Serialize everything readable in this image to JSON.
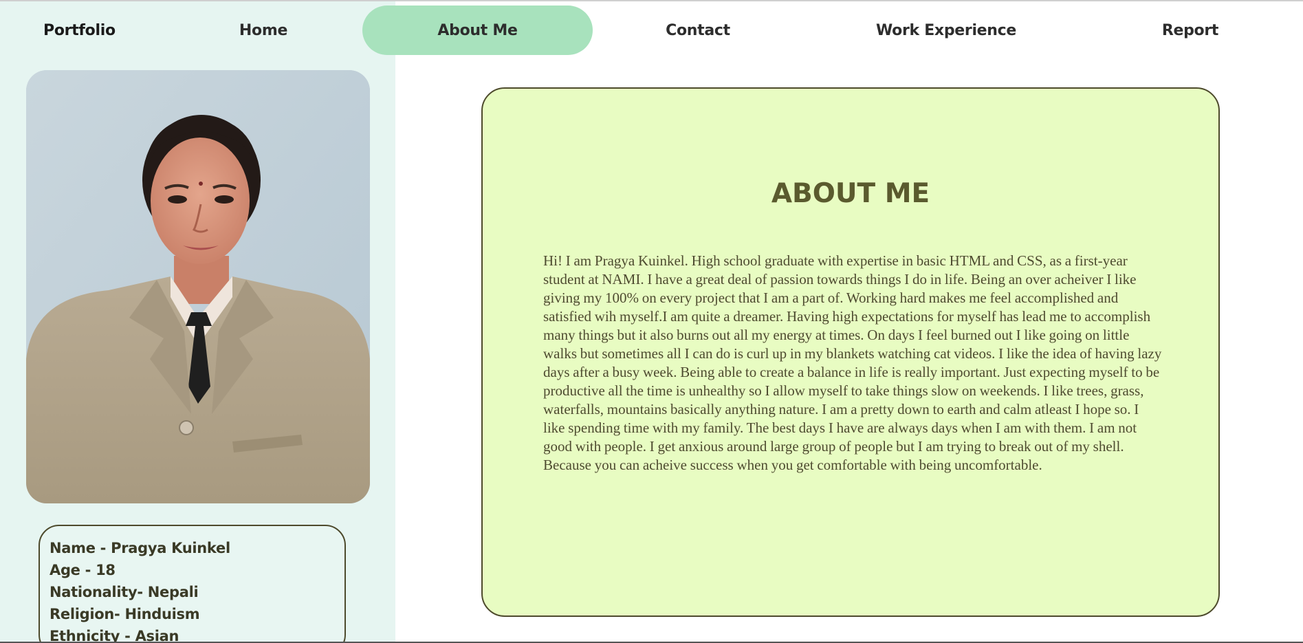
{
  "nav": {
    "brand": "Portfolio",
    "items": [
      {
        "label": "Home",
        "active": false
      },
      {
        "label": "About Me",
        "active": true
      },
      {
        "label": "Contact",
        "active": false
      },
      {
        "label": "Work Experience",
        "active": false
      },
      {
        "label": "Report",
        "active": false
      }
    ]
  },
  "sidebar": {
    "info": [
      "Name - Pragya Kuinkel",
      "Age - 18",
      "Nationality- Nepali",
      "Religion- Hinduism",
      "Ethnicity - Asian"
    ]
  },
  "about": {
    "title": "ABOUT ME",
    "body": "Hi! I am Pragya Kuinkel. High school graduate with expertise in basic HTML and CSS, as a first-year student at NAMI. I have a great deal of passion towards things I do in life. Being an over acheiver I like giving my 100% on every project that I am a part of. Working hard makes me feel accomplished and satisfied wih myself.I am quite a dreamer. Having high expectations for myself has lead me to accomplish many things but it also burns out all my energy at times. On days I feel burned out I like going on little walks but sometimes all I can do is curl up in my blankets watching cat videos. I like the idea of having lazy days after a busy week. Being able to create a balance in life is really important. Just expecting myself to be productive all the time is unhealthy so I allow myself to take things slow on weekends. I like trees, grass, waterfalls, mountains basically anything nature. I am a pretty down to earth and calm atleast I hope so. I like spending time with my family. The best days I have are always days when I am with them. I am not good with people. I get anxious around large group of people but I am trying to break out of my shell. Because you can acheive success when you get comfortable with being uncomfortable."
  },
  "colors": {
    "sidebar_bg": "#e6f5f1",
    "active_tab": "#a8e2bd",
    "card_bg": "#e8fcc2",
    "card_border": "#4d4a2c",
    "title_color": "#5a5a2e"
  }
}
